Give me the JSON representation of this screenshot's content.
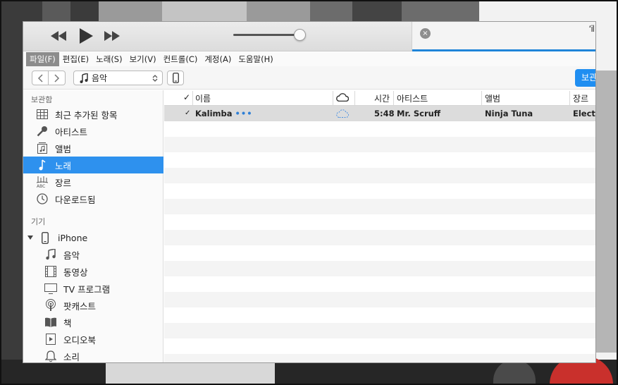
{
  "player": {
    "lcd_apple": "ʻil",
    "lcd_close": "×"
  },
  "menu": [
    "파일(F)",
    "편집(E)",
    "노래(S)",
    "보기(V)",
    "컨트롤(C)",
    "계정(A)",
    "도움말(H)"
  ],
  "toolbar": {
    "media_label": "음악",
    "library_button": "보관"
  },
  "sidebar": {
    "library_title": "보관함",
    "library_items": [
      {
        "label": "최근 추가된 항목",
        "icon": "grid-icon"
      },
      {
        "label": "아티스트",
        "icon": "microphone-icon"
      },
      {
        "label": "앨범",
        "icon": "album-icon"
      },
      {
        "label": "노래",
        "icon": "music-note-icon"
      },
      {
        "label": "장르",
        "icon": "genre-icon"
      },
      {
        "label": "다운로드됨",
        "icon": "download-clock-icon"
      }
    ],
    "devices_title": "기기",
    "device_name": "iPhone",
    "device_items": [
      {
        "label": "음악",
        "icon": "music-note-icon"
      },
      {
        "label": "동영상",
        "icon": "film-icon"
      },
      {
        "label": "TV 프로그램",
        "icon": "tv-icon"
      },
      {
        "label": "팟캐스트",
        "icon": "podcast-icon"
      },
      {
        "label": "책",
        "icon": "book-icon"
      },
      {
        "label": "오디오북",
        "icon": "audiobook-icon"
      },
      {
        "label": "소리",
        "icon": "bell-icon"
      }
    ]
  },
  "songs": {
    "columns": {
      "check": "✓",
      "name": "이름",
      "time": "시간",
      "artist": "아티스트",
      "album": "앨범",
      "genre": "장르"
    },
    "rows": [
      {
        "check": "✓",
        "name": "Kalimba",
        "more": "•••",
        "time": "5:48",
        "artist": "Mr. Scruff",
        "album": "Ninja Tuna",
        "genre": "Electro"
      }
    ]
  },
  "colors": {
    "accent": "#2e91ee",
    "library_button": "#1f8ef1"
  }
}
